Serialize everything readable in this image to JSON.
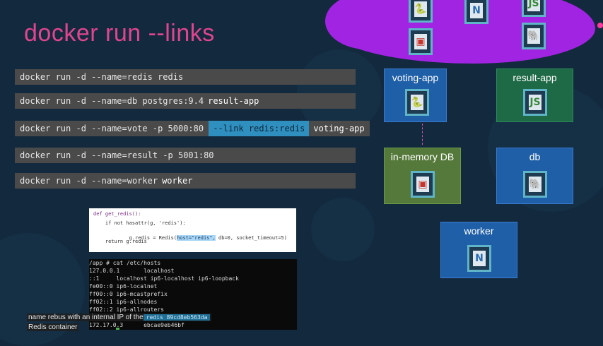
{
  "slide": {
    "title": "docker run --links"
  },
  "commands": [
    {
      "text": "docker run -d --name=redis redis",
      "link": "",
      "tag": ""
    },
    {
      "text": "docker run -d --name=db postgres:9.4",
      "link": "",
      "tag": "result-app"
    },
    {
      "text": "docker run -d --name=vote -p 5000:80",
      "link": "--link redis:redis",
      "tag": "voting-app"
    },
    {
      "text": "docker run -d --name=result -p 5001:80",
      "link": "",
      "tag": ""
    },
    {
      "text": "docker run -d --name=worker",
      "link": "",
      "tag": "worker"
    }
  ],
  "diagram": {
    "voting_app": "voting-app",
    "result_app": "result-app",
    "in_memory_db": "in-memory DB",
    "db": "db",
    "worker": "worker"
  },
  "code": {
    "line1": "def get_redis():",
    "line2": "    if not hasattr(g, 'redis'):",
    "line3_pre": "        g.redis = Redis(",
    "line3_hl": "host=\"redis\",",
    "line3_post": " db=0, socket_timeout=5)",
    "line4": "    return g.redis"
  },
  "terminal": {
    "lines": [
      "/app # cat /etc/hosts",
      "127.0.0.1       localhost",
      "::1     localhost ip6-localhost ip6-loopback",
      "fe00::0 ip6-localnet",
      "ff00::0 ip6-mcastprefix",
      "ff02::1 ip6-allnodes",
      "ff02::2 ip6-allrouters",
      "",
      "172.17.0.3      ebcae9eb46bf"
    ],
    "highlight": "redis 89cd8eb563da"
  },
  "captions": {
    "line1": "name rebus with an internal IP of the",
    "line2": "Redis container"
  },
  "colors": {
    "background": "#132a3e",
    "title": "#e0458f",
    "cloud": "#a224e3",
    "voting_app_box": "#1f5fa8",
    "result_app_box": "#1e6a46",
    "in_memory_db_box": "#55793a",
    "db_box": "#1f5fa8",
    "worker_box": "#1f5fa8"
  },
  "icons": [
    "python-container-icon",
    "redis-container-icon",
    "dotnet-container-icon",
    "nodejs-container-icon",
    "postgres-container-icon"
  ]
}
